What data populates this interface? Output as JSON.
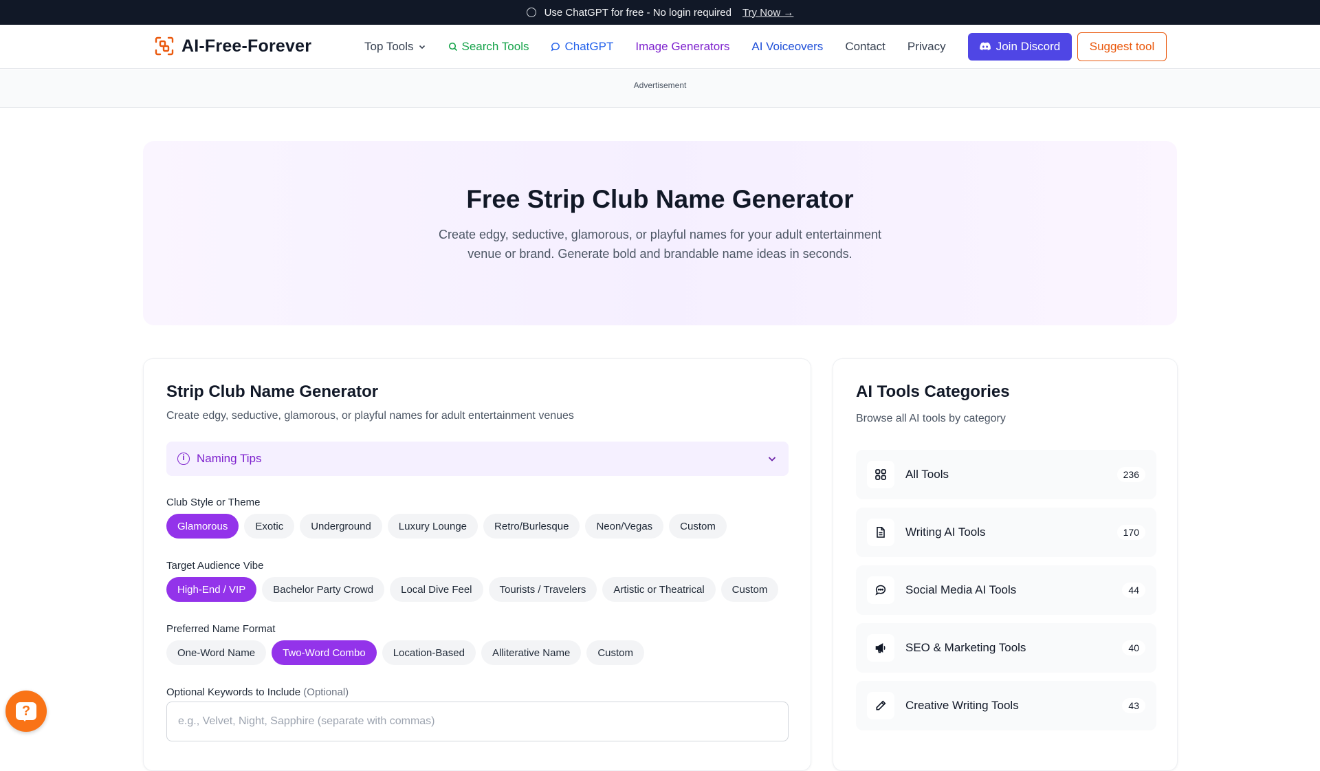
{
  "promo": {
    "text": "Use ChatGPT for free - No login required",
    "link": "Try Now →"
  },
  "nav": {
    "brand": "AI-Free-Forever",
    "links": {
      "top_tools": "Top Tools",
      "search_tools": "Search Tools",
      "chatgpt": "ChatGPT",
      "image_generators": "Image Generators",
      "ai_voiceovers": "AI Voiceovers",
      "contact": "Contact",
      "privacy": "Privacy"
    },
    "join_discord": "Join Discord",
    "suggest_tool": "Suggest tool"
  },
  "ad": {
    "label": "Advertisement"
  },
  "hero": {
    "title": "Free Strip Club Name Generator",
    "description": "Create edgy, seductive, glamorous, or playful names for your adult entertainment venue or brand. Generate bold and brandable name ideas in seconds."
  },
  "generator": {
    "title": "Strip Club Name Generator",
    "subtitle": "Create edgy, seductive, glamorous, or playful names for adult entertainment venues",
    "tips_label": "Naming Tips",
    "style": {
      "label": "Club Style or Theme",
      "options": [
        "Glamorous",
        "Exotic",
        "Underground",
        "Luxury Lounge",
        "Retro/Burlesque",
        "Neon/Vegas",
        "Custom"
      ],
      "selected": "Glamorous"
    },
    "audience": {
      "label": "Target Audience Vibe",
      "options": [
        "High-End / VIP",
        "Bachelor Party Crowd",
        "Local Dive Feel",
        "Tourists / Travelers",
        "Artistic or Theatrical",
        "Custom"
      ],
      "selected": "High-End / VIP"
    },
    "format": {
      "label": "Preferred Name Format",
      "options": [
        "One-Word Name",
        "Two-Word Combo",
        "Location-Based",
        "Alliterative Name",
        "Custom"
      ],
      "selected": "Two-Word Combo"
    },
    "keywords": {
      "label": "Optional Keywords to Include",
      "optional": "(Optional)",
      "placeholder": "e.g., Velvet, Night, Sapphire (separate with commas)",
      "value": ""
    }
  },
  "categories": {
    "title": "AI Tools Categories",
    "subtitle": "Browse all AI tools by category",
    "items": [
      {
        "name": "All Tools",
        "count": "236",
        "icon": "grid-icon"
      },
      {
        "name": "Writing AI Tools",
        "count": "170",
        "icon": "document-icon"
      },
      {
        "name": "Social Media AI Tools",
        "count": "44",
        "icon": "chat-bubble-icon"
      },
      {
        "name": "SEO & Marketing Tools",
        "count": "40",
        "icon": "megaphone-icon"
      },
      {
        "name": "Creative Writing Tools",
        "count": "43",
        "icon": "pencil-icon"
      }
    ]
  },
  "colors": {
    "accent_purple": "#9333ea",
    "discord_indigo": "#4f46e5",
    "suggest_orange": "#ea580c",
    "help_orange": "#f97316"
  }
}
